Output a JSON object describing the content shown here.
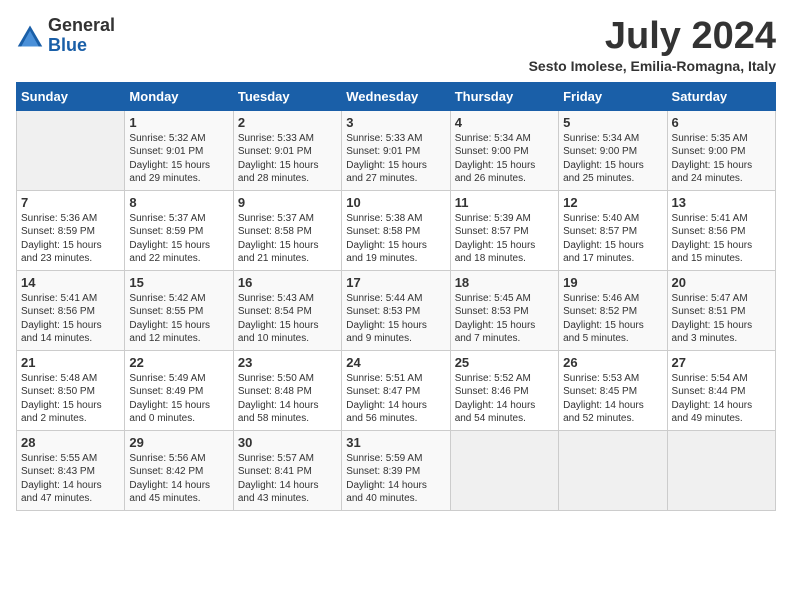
{
  "logo": {
    "general": "General",
    "blue": "Blue"
  },
  "title": "July 2024",
  "location": "Sesto Imolese, Emilia-Romagna, Italy",
  "days_of_week": [
    "Sunday",
    "Monday",
    "Tuesday",
    "Wednesday",
    "Thursday",
    "Friday",
    "Saturday"
  ],
  "weeks": [
    [
      {
        "num": "",
        "info": ""
      },
      {
        "num": "1",
        "info": "Sunrise: 5:32 AM\nSunset: 9:01 PM\nDaylight: 15 hours\nand 29 minutes."
      },
      {
        "num": "2",
        "info": "Sunrise: 5:33 AM\nSunset: 9:01 PM\nDaylight: 15 hours\nand 28 minutes."
      },
      {
        "num": "3",
        "info": "Sunrise: 5:33 AM\nSunset: 9:01 PM\nDaylight: 15 hours\nand 27 minutes."
      },
      {
        "num": "4",
        "info": "Sunrise: 5:34 AM\nSunset: 9:00 PM\nDaylight: 15 hours\nand 26 minutes."
      },
      {
        "num": "5",
        "info": "Sunrise: 5:34 AM\nSunset: 9:00 PM\nDaylight: 15 hours\nand 25 minutes."
      },
      {
        "num": "6",
        "info": "Sunrise: 5:35 AM\nSunset: 9:00 PM\nDaylight: 15 hours\nand 24 minutes."
      }
    ],
    [
      {
        "num": "7",
        "info": "Sunrise: 5:36 AM\nSunset: 8:59 PM\nDaylight: 15 hours\nand 23 minutes."
      },
      {
        "num": "8",
        "info": "Sunrise: 5:37 AM\nSunset: 8:59 PM\nDaylight: 15 hours\nand 22 minutes."
      },
      {
        "num": "9",
        "info": "Sunrise: 5:37 AM\nSunset: 8:58 PM\nDaylight: 15 hours\nand 21 minutes."
      },
      {
        "num": "10",
        "info": "Sunrise: 5:38 AM\nSunset: 8:58 PM\nDaylight: 15 hours\nand 19 minutes."
      },
      {
        "num": "11",
        "info": "Sunrise: 5:39 AM\nSunset: 8:57 PM\nDaylight: 15 hours\nand 18 minutes."
      },
      {
        "num": "12",
        "info": "Sunrise: 5:40 AM\nSunset: 8:57 PM\nDaylight: 15 hours\nand 17 minutes."
      },
      {
        "num": "13",
        "info": "Sunrise: 5:41 AM\nSunset: 8:56 PM\nDaylight: 15 hours\nand 15 minutes."
      }
    ],
    [
      {
        "num": "14",
        "info": "Sunrise: 5:41 AM\nSunset: 8:56 PM\nDaylight: 15 hours\nand 14 minutes."
      },
      {
        "num": "15",
        "info": "Sunrise: 5:42 AM\nSunset: 8:55 PM\nDaylight: 15 hours\nand 12 minutes."
      },
      {
        "num": "16",
        "info": "Sunrise: 5:43 AM\nSunset: 8:54 PM\nDaylight: 15 hours\nand 10 minutes."
      },
      {
        "num": "17",
        "info": "Sunrise: 5:44 AM\nSunset: 8:53 PM\nDaylight: 15 hours\nand 9 minutes."
      },
      {
        "num": "18",
        "info": "Sunrise: 5:45 AM\nSunset: 8:53 PM\nDaylight: 15 hours\nand 7 minutes."
      },
      {
        "num": "19",
        "info": "Sunrise: 5:46 AM\nSunset: 8:52 PM\nDaylight: 15 hours\nand 5 minutes."
      },
      {
        "num": "20",
        "info": "Sunrise: 5:47 AM\nSunset: 8:51 PM\nDaylight: 15 hours\nand 3 minutes."
      }
    ],
    [
      {
        "num": "21",
        "info": "Sunrise: 5:48 AM\nSunset: 8:50 PM\nDaylight: 15 hours\nand 2 minutes."
      },
      {
        "num": "22",
        "info": "Sunrise: 5:49 AM\nSunset: 8:49 PM\nDaylight: 15 hours\nand 0 minutes."
      },
      {
        "num": "23",
        "info": "Sunrise: 5:50 AM\nSunset: 8:48 PM\nDaylight: 14 hours\nand 58 minutes."
      },
      {
        "num": "24",
        "info": "Sunrise: 5:51 AM\nSunset: 8:47 PM\nDaylight: 14 hours\nand 56 minutes."
      },
      {
        "num": "25",
        "info": "Sunrise: 5:52 AM\nSunset: 8:46 PM\nDaylight: 14 hours\nand 54 minutes."
      },
      {
        "num": "26",
        "info": "Sunrise: 5:53 AM\nSunset: 8:45 PM\nDaylight: 14 hours\nand 52 minutes."
      },
      {
        "num": "27",
        "info": "Sunrise: 5:54 AM\nSunset: 8:44 PM\nDaylight: 14 hours\nand 49 minutes."
      }
    ],
    [
      {
        "num": "28",
        "info": "Sunrise: 5:55 AM\nSunset: 8:43 PM\nDaylight: 14 hours\nand 47 minutes."
      },
      {
        "num": "29",
        "info": "Sunrise: 5:56 AM\nSunset: 8:42 PM\nDaylight: 14 hours\nand 45 minutes."
      },
      {
        "num": "30",
        "info": "Sunrise: 5:57 AM\nSunset: 8:41 PM\nDaylight: 14 hours\nand 43 minutes."
      },
      {
        "num": "31",
        "info": "Sunrise: 5:59 AM\nSunset: 8:39 PM\nDaylight: 14 hours\nand 40 minutes."
      },
      {
        "num": "",
        "info": ""
      },
      {
        "num": "",
        "info": ""
      },
      {
        "num": "",
        "info": ""
      }
    ]
  ]
}
